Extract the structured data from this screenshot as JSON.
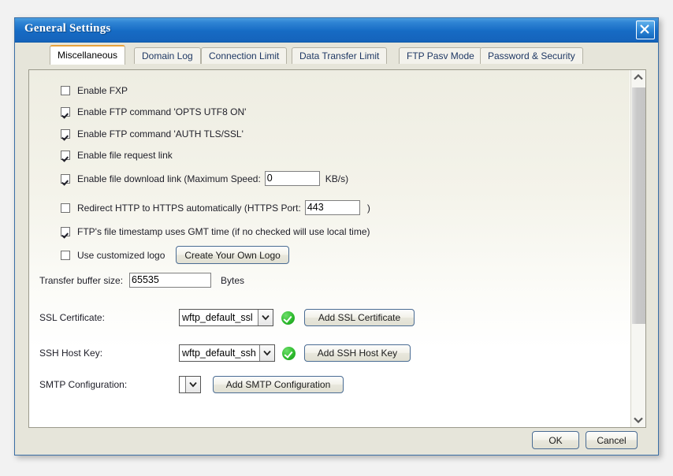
{
  "window": {
    "title": "General Settings",
    "close_icon": "close-x-icon"
  },
  "tabs": [
    {
      "label": "Miscellaneous",
      "active": true
    },
    {
      "label": "Domain Log",
      "active": false
    },
    {
      "label": "Connection Limit",
      "active": false
    },
    {
      "label": "Data Transfer Limit",
      "active": false
    },
    {
      "label": "FTP Pasv Mode",
      "active": false
    },
    {
      "label": "Password & Security",
      "active": false
    }
  ],
  "checkboxes": {
    "enable_fxp": {
      "label": "Enable FXP",
      "checked": false
    },
    "opts_utf8": {
      "label": "Enable FTP command 'OPTS UTF8 ON'",
      "checked": true
    },
    "auth_tls": {
      "label": "Enable FTP command 'AUTH TLS/SSL'",
      "checked": true
    },
    "file_request_link": {
      "label": "Enable file request link",
      "checked": true
    },
    "file_download_link": {
      "label": "Enable file download link (Maximum Speed:",
      "checked": true,
      "value": "0",
      "suffix": "KB/s)"
    },
    "redirect_https": {
      "label": "Redirect HTTP to HTTPS automatically (HTTPS Port:",
      "checked": false,
      "value": "443",
      "suffix": ")"
    },
    "gmt_timestamp": {
      "label": "FTP's file timestamp uses GMT time (if no checked will use local time)",
      "checked": true
    },
    "custom_logo": {
      "label": "Use customized logo",
      "checked": false,
      "button": "Create Your Own Logo"
    }
  },
  "fields": {
    "transfer_buffer": {
      "label": "Transfer buffer size:",
      "value": "65535",
      "unit": "Bytes"
    },
    "ssl_certificate": {
      "label": "SSL Certificate:",
      "value": "wftp_default_ssl",
      "status": "valid-check-icon",
      "button": "Add SSL Certificate"
    },
    "ssh_host_key": {
      "label": "SSH Host Key:",
      "value": "wftp_default_ssh",
      "status": "valid-check-icon",
      "button": "Add SSH Host Key"
    },
    "smtp_configuration": {
      "label": "SMTP Configuration:",
      "value": "",
      "button": "Add SMTP Configuration"
    }
  },
  "scrollbar": {
    "up_icon": "chevron-up-icon",
    "down_icon": "chevron-down-icon"
  },
  "footer": {
    "ok": "OK",
    "cancel": "Cancel"
  }
}
